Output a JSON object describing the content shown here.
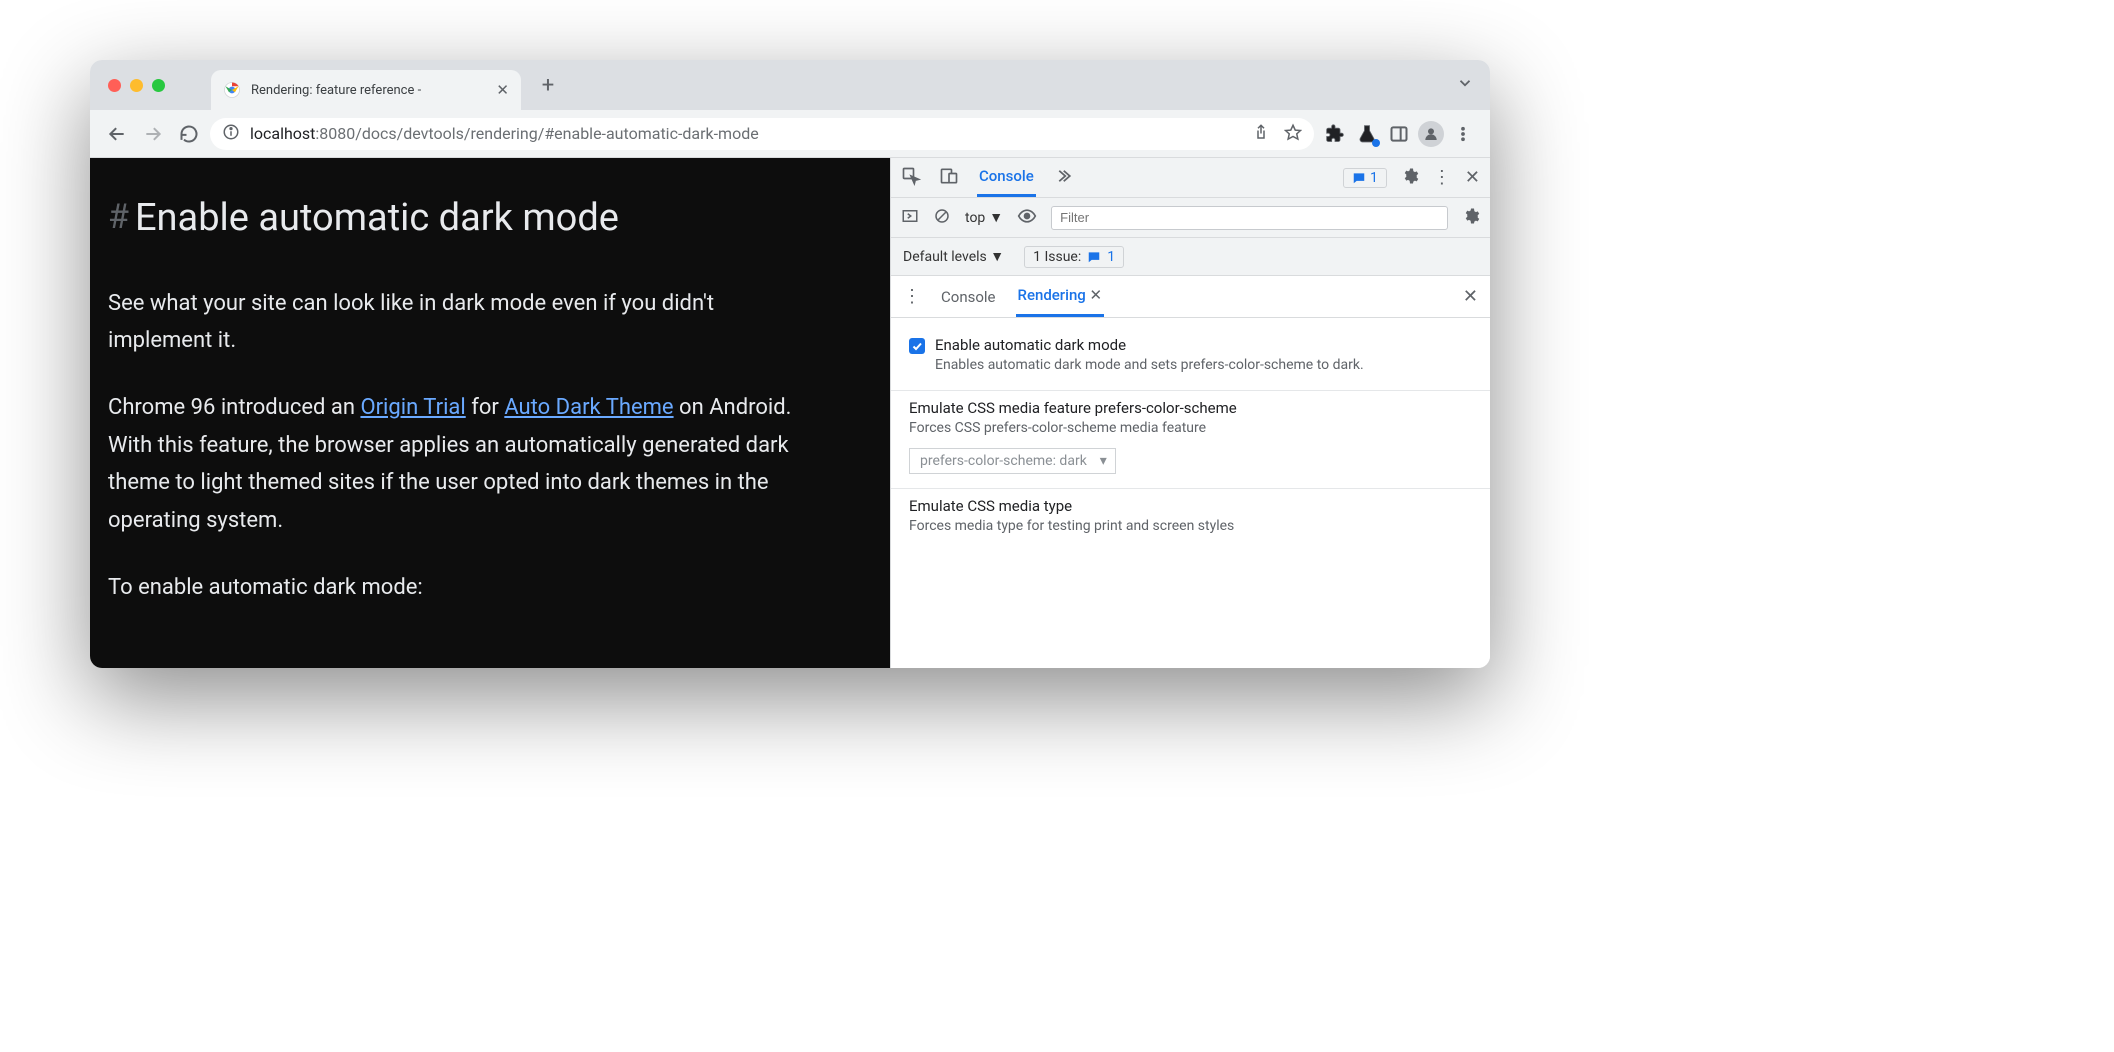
{
  "tab": {
    "title": "Rendering: feature reference -"
  },
  "url": {
    "host": "localhost",
    "port": ":8080",
    "path": "/docs/devtools/rendering/#enable-automatic-dark-mode"
  },
  "page": {
    "heading": "Enable automatic dark mode",
    "p1": "See what your site can look like in dark mode even if you didn't implement it.",
    "p2a": "Chrome 96 introduced an ",
    "link1": "Origin Trial",
    "p2b": " for ",
    "link2": "Auto Dark Theme",
    "p2c": " on Android. With this feature, the browser applies an automatically generated dark theme to light themed sites if the user opted into dark themes in the operating system.",
    "p3": "To enable automatic dark mode:"
  },
  "devtools": {
    "tabs": {
      "console": "Console"
    },
    "issue_count": "1",
    "scope": "top",
    "filter_placeholder": "Filter",
    "levels": "Default levels",
    "issues_label": "1 Issue:",
    "issues_count2": "1",
    "drawer": {
      "tab_console": "Console",
      "tab_rendering": "Rendering"
    },
    "sec1": {
      "title": "Enable automatic dark mode",
      "desc": "Enables automatic dark mode and sets prefers-color-scheme to dark."
    },
    "sec2": {
      "title": "Emulate CSS media feature prefers-color-scheme",
      "desc": "Forces CSS prefers-color-scheme media feature",
      "select": "prefers-color-scheme: dark"
    },
    "sec3": {
      "title": "Emulate CSS media type",
      "desc": "Forces media type for testing print and screen styles"
    }
  }
}
